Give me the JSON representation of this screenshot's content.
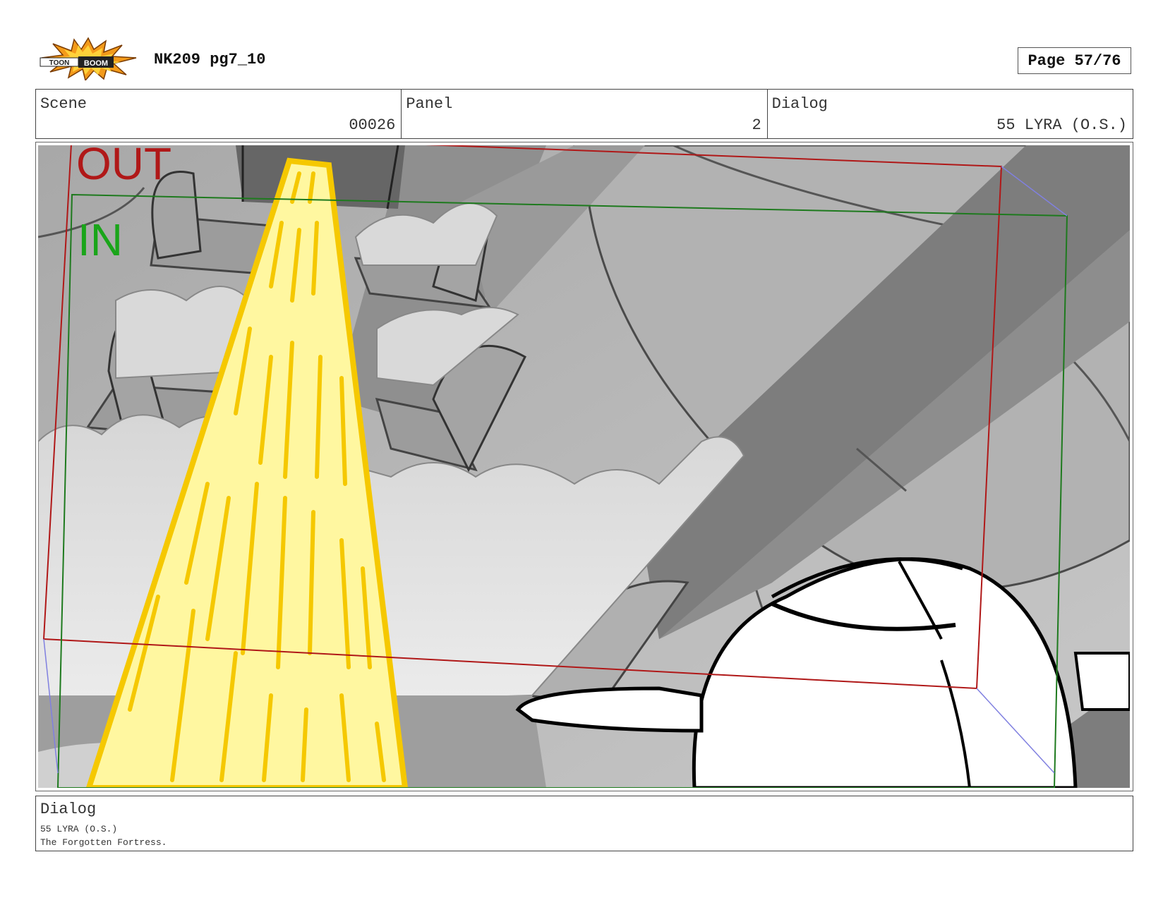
{
  "header": {
    "logo_text": "TOON BOOM",
    "title": "NK209 pg7_10",
    "page_label": "Page 57/76"
  },
  "info": {
    "scene_label": "Scene",
    "scene_value": "00026",
    "panel_label": "Panel",
    "panel_value": "2",
    "dialog_label": "Dialog",
    "dialog_value": "55 LYRA (O.S.)"
  },
  "panel": {
    "out_label": "OUT",
    "in_label": "IN",
    "colors": {
      "out_frame": "#b01818",
      "in_frame": "#1e7a1e",
      "light_beam": "#fff7a0",
      "light_beam_stroke": "#f5c800"
    }
  },
  "dialog_box": {
    "heading": "Dialog",
    "speaker": "55 LYRA (O.S.)",
    "line": "The Forgotten Fortress."
  }
}
